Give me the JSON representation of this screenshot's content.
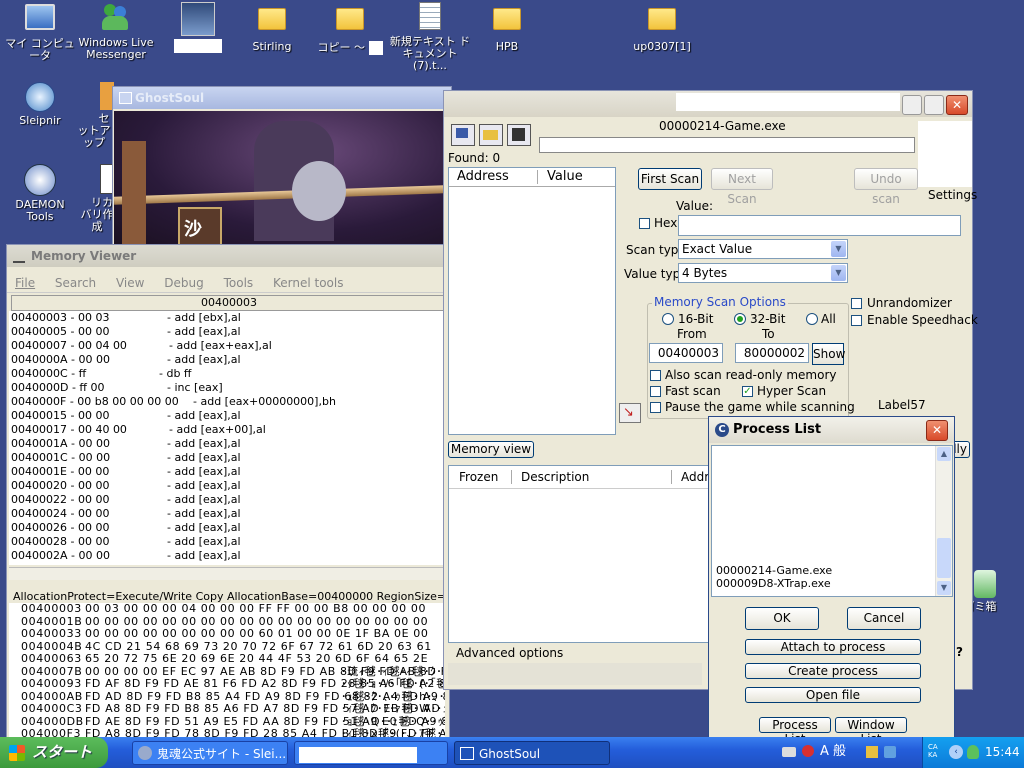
{
  "desktop": {
    "icons": [
      {
        "label": "マイ コンピュータ",
        "icon": "computer-icon"
      },
      {
        "label": "Windows Live Messenger",
        "icon": "messenger-icon"
      },
      {
        "label": "",
        "icon": "app-icon"
      },
      {
        "label": "Stirling",
        "icon": "folder-icon"
      },
      {
        "label": "コピー ～",
        "icon": "folder-icon"
      },
      {
        "label": "新規テキスト ドキュメント (7).t...",
        "icon": "text-file-icon"
      },
      {
        "label": "HPB",
        "icon": "folder-icon"
      },
      {
        "label": "up0307[1]",
        "icon": "folder-icon"
      },
      {
        "label": "Sleipnir",
        "icon": "browser-icon"
      },
      {
        "label": "セットアップ",
        "icon": "setup-icon"
      },
      {
        "label": "DAEMON Tools",
        "icon": "daemon-tools-icon"
      },
      {
        "label": "リカバリ作成",
        "icon": "app-icon"
      },
      {
        "label": "ゴミ箱",
        "icon": "recycle-bin-icon"
      }
    ]
  },
  "ghostsoul": {
    "title": "GhostSoul",
    "sign_text": "沙"
  },
  "memory_viewer": {
    "title": "Memory Viewer",
    "menu": [
      "File",
      "Search",
      "View",
      "Debug",
      "Tools",
      "Kernel tools"
    ],
    "address_header": "00400003",
    "disasm": [
      {
        "addr": "00400003 - 00 03",
        "ins": "- add [ebx],al"
      },
      {
        "addr": "00400005 - 00 00",
        "ins": "- add [eax],al"
      },
      {
        "addr": "00400007 - 00 04 00",
        "ins": "- add [eax+eax],al"
      },
      {
        "addr": "0040000A - 00 00",
        "ins": "- add [eax],al"
      },
      {
        "addr": "0040000C - ff",
        "ins": "- db ff"
      },
      {
        "addr": "0040000D - ff 00",
        "ins": "- inc [eax]"
      },
      {
        "addr": "0040000F - 00 b8 00 00 00 00",
        "ins": "- add [eax+00000000],bh"
      },
      {
        "addr": "00400015 - 00 00",
        "ins": "- add [eax],al"
      },
      {
        "addr": "00400017 - 00 40 00",
        "ins": "- add [eax+00],al"
      },
      {
        "addr": "0040001A - 00 00",
        "ins": "- add [eax],al"
      },
      {
        "addr": "0040001C - 00 00",
        "ins": "- add [eax],al"
      },
      {
        "addr": "0040001E - 00 00",
        "ins": "- add [eax],al"
      },
      {
        "addr": "00400020 - 00 00",
        "ins": "- add [eax],al"
      },
      {
        "addr": "00400022 - 00 00",
        "ins": "- add [eax],al"
      },
      {
        "addr": "00400024 - 00 00",
        "ins": "- add [eax],al"
      },
      {
        "addr": "00400026 - 00 00",
        "ins": "- add [eax],al"
      },
      {
        "addr": "00400028 - 00 00",
        "ins": "- add [eax],al"
      },
      {
        "addr": "0040002A - 00 00",
        "ins": "- add [eax],al"
      }
    ],
    "alloc_info": "AllocationProtect=Execute/Write Copy  AllocationBase=00400000 RegionSize=1000",
    "hex": [
      {
        "addr": "00400003",
        "bytes": "00 03 00 00 00 04 00 00 00 FF FF 00 00 B8 00 00 00 00",
        "ascii": ""
      },
      {
        "addr": "0040001B",
        "bytes": "00 00 00 00 00 00 00 00 00 00 00 00 00 00 00 00 00 00",
        "ascii": ""
      },
      {
        "addr": "00400033",
        "bytes": "00 00 00 00 00 00 00 00 00 60 01 00 00 0E 1F BA 0E 00",
        "ascii": ""
      },
      {
        "addr": "0040004B",
        "bytes": "4C CD 21 54 68 69 73 20 70 72 6F 67 72 61 6D 20 63 61",
        "ascii": ""
      },
      {
        "addr": "00400063",
        "bytes": "65 20 72 75 6E 20 69 6E 20 44 4F 53 20 6D 6F 64 65 2E",
        "ascii": ""
      },
      {
        "addr": "0040007B",
        "bytes": "00 00 00 00 EF EC 97 AE AB 8D F9 FD AB 8D F9 FD AB 8D F9 FD B8 85 90",
        "ascii": "･琉ｨ毬･ｨ毬･ｨ毬･ｸ･"
      },
      {
        "addr": "00400093",
        "bytes": "FD AF 8D F9 FD AE 81 F6 FD A2 8D F9 FD 28 85 A6 FD A2 8D F9",
        "ascii": "･ｯ毬･ｮ･ｿ･｢毬･(･｢毬"
      },
      {
        "addr": "004000AB",
        "bytes": "FD AD 8D F9 FD B8 85 A4 FD A9 8D F9 FD 68 82 A4 FD A9 8D F9",
        "ascii": "･ｭ毬･ｸ･､･ｩ毬･h･､･ｩ毬"
      },
      {
        "addr": "004000C3",
        "bytes": "FD A8 8D F9 FD B8 85 A6 FD A7 8D F9 FD 57 AD EB FD AD 8D F9",
        "ascii": "･ｨ毬･ｸ･ｦ･ｧ毬･W･･ｭ毬"
      },
      {
        "addr": "004000DB",
        "bytes": "FD AE 8D F9 FD 51 A9 E5 FD AA 8D F9 FD 51 A9 E0 FD A9 8D F9",
        "ascii": "･ｮ毬･Q･･ｪ毬･Q･･ｩ毬"
      },
      {
        "addr": "004000F3",
        "bytes": "FD A8 8D F9 FD 78 8D F9 FD 28 85 A4 FD B1 8D F9 FD FF AE C8",
        "ascii": "･ｨ毬･x毬･(･､･ｱ毬･･"
      }
    ]
  },
  "cheat_engine": {
    "process_name": "00000214-Game.exe",
    "found": "Found: 0",
    "col_address": "Address",
    "col_value": "Value",
    "first_scan": "First Scan",
    "next_scan": "Next Scan",
    "undo_scan": "Undo scan",
    "settings": "Settings",
    "value_label": "Value:",
    "hex_label": "Hex",
    "value_input": "",
    "scan_type_label": "Scan type",
    "scan_type_value": "Exact Value",
    "value_type_label": "Value type",
    "value_type_value": "4 Bytes",
    "memory_scan_options": "Memory Scan Options",
    "radio_16": "16-Bit",
    "radio_32": "32-Bit",
    "radio_all": "All",
    "from_label": "From",
    "to_label": "To",
    "from_value": "00400003",
    "to_value": "80000002",
    "show": "Show",
    "also_readonly": "Also scan read-only memory",
    "fast_scan": "Fast scan",
    "hyper_scan": "Hyper Scan",
    "pause_game": "Pause the game while scanning",
    "unrandomizer": "Unrandomizer",
    "enable_speedhack": "Enable Speedhack",
    "label57": "Label57",
    "memory_view": "Memory view",
    "col_frozen": "Frozen",
    "col_description": "Description",
    "col_address2": "Addre",
    "advanced_options": "Advanced options",
    "add_manually": "lly",
    "help": "?"
  },
  "process_list": {
    "title": "Process List",
    "processes": [
      "00000214-Game.exe",
      "000009D8-XTrap.exe"
    ],
    "ok": "OK",
    "cancel": "Cancel",
    "attach": "Attach to process",
    "create": "Create process",
    "open_file": "Open file",
    "tab_process": "Process List",
    "tab_window": "Window List"
  },
  "taskbar": {
    "start": "スタート",
    "buttons": [
      "鬼魂公式サイト - Slei...",
      "",
      "GhostSoul"
    ],
    "ime_mode": "A 般",
    "clock": "15:44"
  },
  "colors": {
    "xp_blue": "#245edb",
    "start_green": "#3c9a3c",
    "title_red": "#d84a2a"
  }
}
